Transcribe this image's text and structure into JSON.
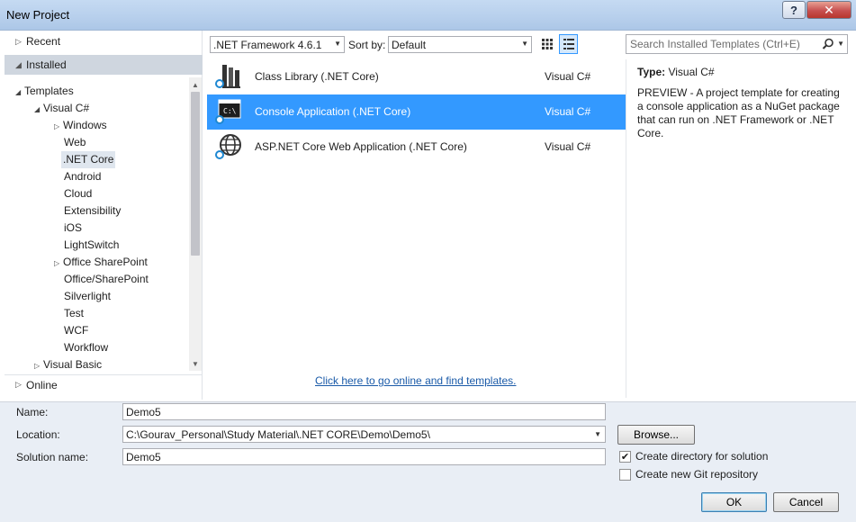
{
  "window": {
    "title": "New Project",
    "help_label": "?",
    "close_label": "✕"
  },
  "nav": {
    "recent": "Recent",
    "installed": "Installed",
    "online": "Online",
    "tree": {
      "templates": "Templates",
      "visual_csharp": "Visual C#",
      "items": [
        "Windows",
        "Web",
        ".NET Core",
        "Android",
        "Cloud",
        "Extensibility",
        "iOS",
        "LightSwitch",
        "Office SharePoint",
        "Office/SharePoint",
        "Silverlight",
        "Test",
        "WCF",
        "Workflow"
      ],
      "visual_basic": "Visual Basic"
    }
  },
  "toolbar": {
    "framework": ".NET Framework 4.6.1",
    "sort_label": "Sort by:",
    "sort_value": "Default",
    "search_placeholder": "Search Installed Templates (Ctrl+E)"
  },
  "templates": [
    {
      "name": "Class Library (.NET Core)",
      "lang": "Visual C#",
      "icon": "class-library-icon"
    },
    {
      "name": "Console Application (.NET Core)",
      "lang": "Visual C#",
      "icon": "console-app-icon"
    },
    {
      "name": "ASP.NET Core Web Application (.NET Core)",
      "lang": "Visual C#",
      "icon": "web-app-icon"
    }
  ],
  "online_link": "Click here to go online and find templates.",
  "details": {
    "type_label": "Type:",
    "type_value": "Visual C#",
    "description": "PREVIEW - A project template for creating a console application as a NuGet package that can run on .NET Framework or .NET Core."
  },
  "form": {
    "name_label": "Name:",
    "name_value": "Demo5",
    "location_label": "Location:",
    "location_value": "C:\\Gourav_Personal\\Study Material\\.NET CORE\\Demo\\Demo5\\",
    "solution_label": "Solution name:",
    "solution_value": "Demo5",
    "browse": "Browse...",
    "create_dir": "Create directory for solution",
    "create_git": "Create new Git repository",
    "ok": "OK",
    "cancel": "Cancel"
  },
  "colors": {
    "selection": "#3399ff",
    "link": "#1a5aa8"
  }
}
